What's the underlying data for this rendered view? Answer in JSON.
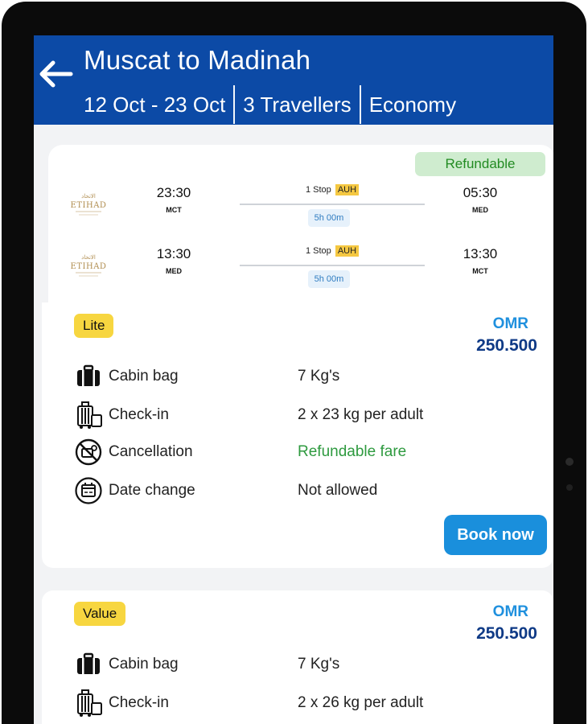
{
  "header": {
    "title": "Muscat to Madinah",
    "dates": "12 Oct - 23 Oct",
    "travellers": "3 Travellers",
    "cabin_class": "Economy"
  },
  "flight": {
    "refund_badge": "Refundable",
    "legs": [
      {
        "airline": "ETIHAD",
        "dep_time": "23:30",
        "dep_code": "MCT",
        "stops": "1 Stop",
        "via": "AUH",
        "duration": "5h 00m",
        "arr_time": "05:30",
        "arr_code": "MED"
      },
      {
        "airline": "ETIHAD",
        "dep_time": "13:30",
        "dep_code": "MED",
        "stops": "1 Stop",
        "via": "AUH",
        "duration": "5h 00m",
        "arr_time": "13:30",
        "arr_code": "MCT"
      }
    ]
  },
  "fares": [
    {
      "name": "Lite",
      "currency": "OMR",
      "price": "250.500",
      "features": [
        {
          "icon": "suitcase-icon",
          "label": "Cabin bag",
          "value": "7 Kg's"
        },
        {
          "icon": "luggage-trolley-icon",
          "label": "Check-in",
          "value": "2 x 23 kg per adult"
        },
        {
          "icon": "no-cancellation-icon",
          "label": "Cancellation",
          "value": "Refundable fare"
        },
        {
          "icon": "calendar-icon",
          "label": "Date change",
          "value": "Not allowed"
        }
      ],
      "book_label": "Book now"
    },
    {
      "name": "Value",
      "currency": "OMR",
      "price": "250.500",
      "features": [
        {
          "icon": "suitcase-icon",
          "label": "Cabin bag",
          "value": "7 Kg's"
        },
        {
          "icon": "luggage-trolley-icon",
          "label": "Check-in",
          "value": "2 x 26 kg per adult"
        }
      ]
    }
  ],
  "colors": {
    "header_bg": "#0c4aa6",
    "refund_green": "#2e9a3f",
    "price_blue": "#0f3a86",
    "currency_blue": "#1f90de",
    "badge_yellow": "#f7d640",
    "button_blue": "#1a8fdc"
  }
}
